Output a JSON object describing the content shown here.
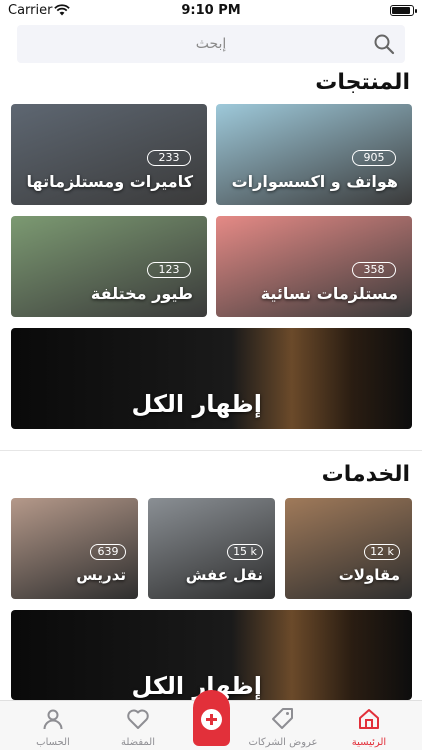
{
  "status_bar": {
    "carrier": "Carrier",
    "time": "9:10 PM",
    "battery_level": 0.9
  },
  "search": {
    "placeholder": "إبحث",
    "icon": "search-icon"
  },
  "products": {
    "title": "المنتجات",
    "tiles": [
      {
        "label": "هواتف و اكسسوارات",
        "count": "905",
        "theme": "#9ec9da"
      },
      {
        "label": "كاميرات ومستلزماتها",
        "count": "233",
        "theme": "#5e6772"
      },
      {
        "label": "مستلزمات نسائية",
        "count": "358",
        "theme": "#e58a86"
      },
      {
        "label": "طيور مختلفة",
        "count": "123",
        "theme": "#7c9a72"
      }
    ],
    "show_all": "إظهار الكل"
  },
  "services": {
    "title": "الخدمات",
    "tiles": [
      {
        "label": "مقاولات",
        "count": "12 k",
        "theme": "#a07a5a"
      },
      {
        "label": "نقل عفش",
        "count": "15 k",
        "theme": "#8a8f94"
      },
      {
        "label": "تدريس",
        "count": "639",
        "theme": "#b5998a"
      }
    ],
    "show_all": "إظهار الكل"
  },
  "tabbar": {
    "items": [
      {
        "label": "الرئيسية",
        "icon": "home-icon",
        "active": true
      },
      {
        "label": "عروض الشركات",
        "icon": "tag-icon",
        "active": false
      },
      {
        "label": "المفضلة",
        "icon": "heart-icon",
        "active": false
      },
      {
        "label": "الحساب",
        "icon": "person-icon",
        "active": false
      }
    ],
    "fab_icon": "plus-icon"
  },
  "colors": {
    "accent": "#e2303a",
    "search_bg": "#f3f4f9",
    "inactive_tab": "#8e8e93"
  }
}
